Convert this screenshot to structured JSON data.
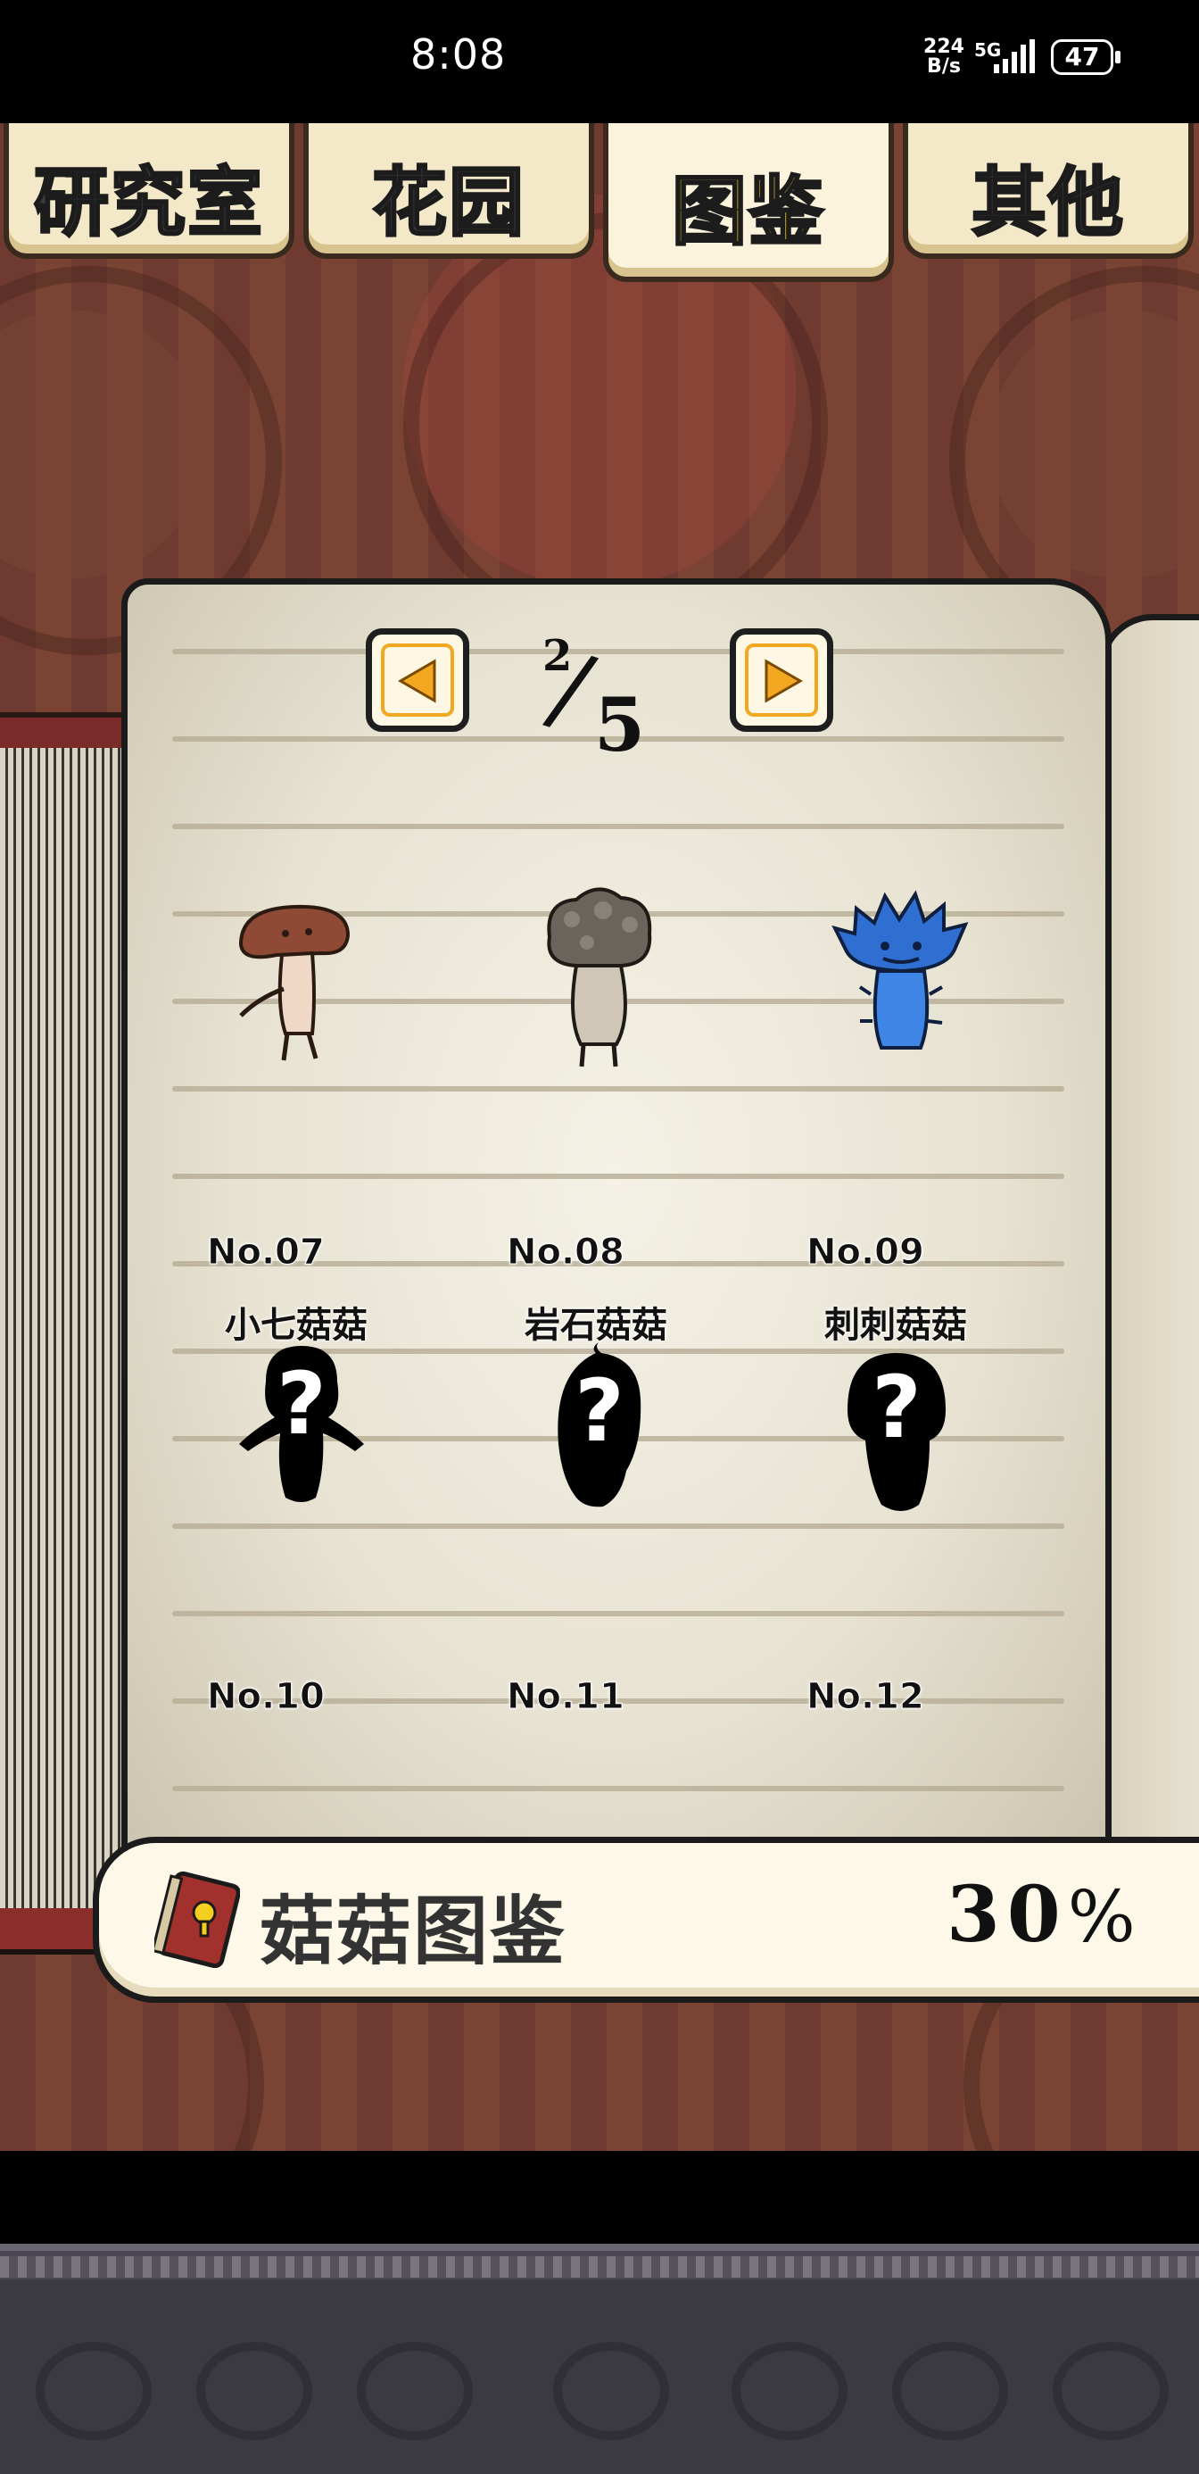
{
  "status_bar": {
    "time": "8:08",
    "net_speed_value": "224",
    "net_speed_unit": "B/s",
    "network": "5G",
    "battery": "47"
  },
  "tabs": [
    {
      "label": "研究室",
      "active": false
    },
    {
      "label": "花园",
      "active": false
    },
    {
      "label": "图鉴",
      "active": true
    },
    {
      "label": "其他",
      "active": false
    }
  ],
  "pager": {
    "current": "2",
    "total": "5"
  },
  "entries": [
    {
      "number": "No.07",
      "name": "小七菇菇",
      "unlocked": true,
      "color": "#8f4a35"
    },
    {
      "number": "No.08",
      "name": "岩石菇菇",
      "unlocked": true,
      "color": "#6b645c"
    },
    {
      "number": "No.09",
      "name": "刺刺菇菇",
      "unlocked": true,
      "color": "#2f6fd1"
    },
    {
      "number": "No.10",
      "name": "",
      "unlocked": false,
      "color": "#000000"
    },
    {
      "number": "No.11",
      "name": "",
      "unlocked": false,
      "color": "#000000"
    },
    {
      "number": "No.12",
      "name": "",
      "unlocked": false,
      "color": "#000000"
    }
  ],
  "collection": {
    "label": "菇菇图鉴",
    "percent": "30",
    "percent_sign": "%"
  },
  "colors": {
    "accent": "#f5cf1f",
    "nav_orange": "#f2a820",
    "book_cover": "#7b2a2a"
  },
  "icons": {
    "prev": "left-arrow-icon",
    "next": "right-arrow-icon",
    "book": "book-icon",
    "unknown": "question-mark-icon"
  }
}
